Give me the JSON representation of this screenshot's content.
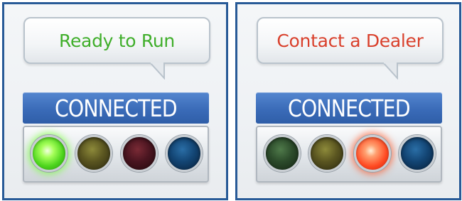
{
  "panels": [
    {
      "message": "Ready to Run",
      "message_color": "#3fae2a",
      "status": "CONNECTED",
      "lights": [
        {
          "color": "green",
          "state": "on"
        },
        {
          "color": "yellow",
          "state": "off"
        },
        {
          "color": "red",
          "state": "off"
        },
        {
          "color": "blue",
          "state": "off"
        }
      ]
    },
    {
      "message": "Contact a Dealer",
      "message_color": "#d9402c",
      "status": "CONNECTED",
      "lights": [
        {
          "color": "green",
          "state": "off"
        },
        {
          "color": "yellow",
          "state": "off"
        },
        {
          "color": "red",
          "state": "on"
        },
        {
          "color": "blue",
          "state": "off"
        }
      ]
    }
  ],
  "colors": {
    "frame_border": "#285a97",
    "status_bar": "#3a6bb8",
    "status_text": "#ffffff"
  }
}
